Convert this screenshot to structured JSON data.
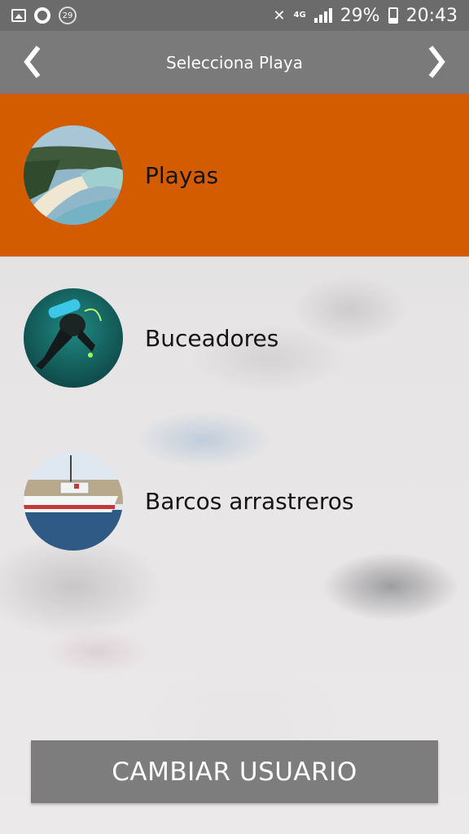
{
  "status_bar": {
    "notification_badge": "29",
    "network": "4G",
    "battery_percent": "29%",
    "time": "20:43",
    "icons": [
      "image-icon",
      "sync-ring-icon",
      "badge-icon",
      "mute-icon",
      "signal-icon",
      "battery-icon"
    ]
  },
  "header": {
    "title": "Selecciona Playa",
    "prev_icon": "chevron-left-icon",
    "next_icon": "chevron-right-icon"
  },
  "items": [
    {
      "label": "Playas",
      "selected": true,
      "thumbnail": "beach-aerial-photo"
    },
    {
      "label": "Buceadores",
      "selected": false,
      "thumbnail": "scuba-diver-photo"
    },
    {
      "label": "Barcos arrastreros",
      "selected": false,
      "thumbnail": "trawler-boat-photo"
    }
  ],
  "footer_button": {
    "label": "CAMBIAR USUARIO"
  },
  "colors": {
    "accent": "#d35c00",
    "header": "#7a7a7a",
    "status_bar": "#6b6b6b",
    "button": "#7d7d7d"
  }
}
